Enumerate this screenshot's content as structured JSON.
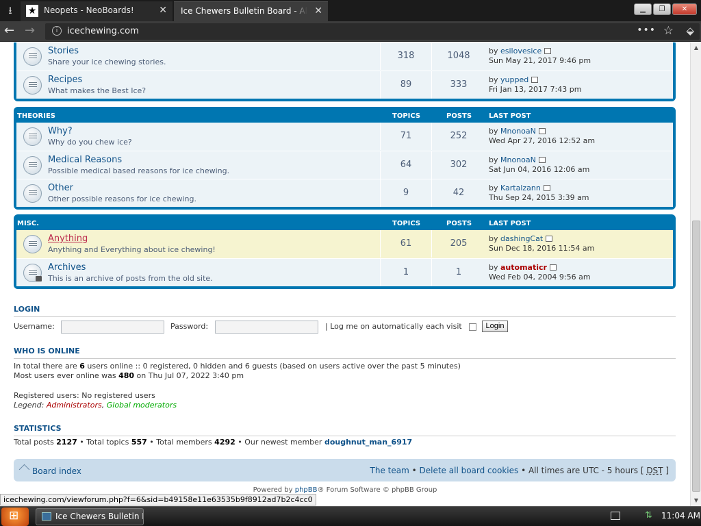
{
  "browser": {
    "tabs": [
      {
        "title": "Neopets - NeoBoards!",
        "active": false
      },
      {
        "title": "Ice Chewers Bulletin Board - All about i",
        "active": true
      }
    ],
    "url": "icechewing.com"
  },
  "forums_top": [
    {
      "title": "Stories",
      "desc": "Share your ice chewing stories.",
      "topics": "318",
      "posts": "1048",
      "last_by": "esilovesice",
      "last_date": "Sun May 21, 2017 9:46 pm"
    },
    {
      "title": "Recipes",
      "desc": "What makes the Best Ice?",
      "topics": "89",
      "posts": "333",
      "last_by": "yupped",
      "last_date": "Fri Jan 13, 2017 7:43 pm"
    }
  ],
  "theories": {
    "heading": "THEORIES",
    "col_topics": "TOPICS",
    "col_posts": "POSTS",
    "col_last": "LAST POST",
    "rows": [
      {
        "title": "Why?",
        "desc": "Why do you chew ice?",
        "topics": "71",
        "posts": "252",
        "last_by": "MnonoaN",
        "last_date": "Wed Apr 27, 2016 12:52 am"
      },
      {
        "title": "Medical Reasons",
        "desc": "Possible medical based reasons for ice chewing.",
        "topics": "64",
        "posts": "302",
        "last_by": "MnonoaN",
        "last_date": "Sat Jun 04, 2016 12:06 am"
      },
      {
        "title": "Other",
        "desc": "Other possible reasons for ice chewing.",
        "topics": "9",
        "posts": "42",
        "last_by": "Kartalzann",
        "last_date": "Thu Sep 24, 2015 3:39 am"
      }
    ]
  },
  "misc": {
    "heading": "MISC.",
    "col_topics": "TOPICS",
    "col_posts": "POSTS",
    "col_last": "LAST POST",
    "rows": [
      {
        "title": "Anything",
        "desc": "Anything and Everything about ice chewing!",
        "topics": "61",
        "posts": "205",
        "last_by": "dashingCat",
        "last_date": "Sun Dec 18, 2016 11:54 am"
      },
      {
        "title": "Archives",
        "desc": "This is an archive of posts from the old site.",
        "topics": "1",
        "posts": "1",
        "last_by": "automaticr",
        "last_date": "Wed Feb 04, 2004 9:56 am"
      }
    ]
  },
  "by_prefix": "by",
  "login": {
    "heading": "LOGIN",
    "username_label": "Username:",
    "password_label": "Password:",
    "remember_label": "| Log me on automatically each visit",
    "button": "Login"
  },
  "online": {
    "heading": "WHO IS ONLINE",
    "line1_a": "In total there are ",
    "line1_count": "6",
    "line1_b": " users online :: 0 registered, 0 hidden and 6 guests (based on users active over the past 5 minutes)",
    "line2_a": "Most users ever online was ",
    "line2_count": "480",
    "line2_b": " on Thu Jul 07, 2022 3:40 pm",
    "registered": "Registered users: No registered users",
    "legend_label": "Legend:",
    "legend_admin": "Administrators",
    "legend_sep": ",",
    "legend_mod": "Global moderators"
  },
  "stats": {
    "heading": "STATISTICS",
    "posts_label": "Total posts ",
    "posts": "2127",
    "topics_label": " • Total topics ",
    "topics": "557",
    "members_label": " • Total members ",
    "members": "4292",
    "newest_label": " • Our newest member ",
    "newest": "doughnut_man_6917"
  },
  "footer": {
    "board_index": "Board index",
    "team": "The team",
    "sep": " • ",
    "delete_cookies": "Delete all board cookies",
    "times": " • All times are UTC - 5 hours [ ",
    "dst": "DST",
    "times_end": " ]",
    "powered_a": "Powered by ",
    "phpbb": "phpBB",
    "powered_b": "® Forum Software © phpBB Group"
  },
  "status_url": "icechewing.com/viewforum.php?f=6&sid=b49158e11e63535b9f8912ad7b2c4cc0",
  "taskbar": {
    "item": "Ice Chewers Bulletin B...",
    "clock": "11:04 AM"
  },
  "colors": {
    "forum_blue": "#0076b1",
    "link": "#105289",
    "admin": "#aa0000",
    "moderator": "#00aa00",
    "highlight_row": "#f6f4d0"
  }
}
